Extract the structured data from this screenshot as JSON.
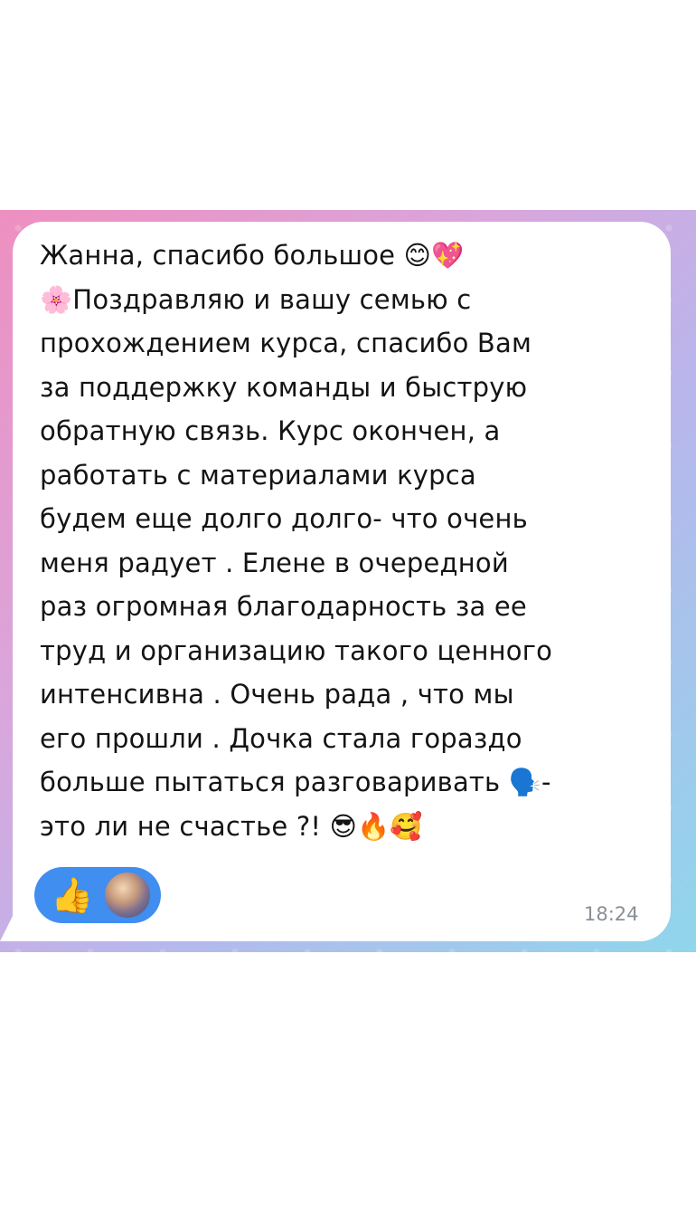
{
  "colors": {
    "bubble": "#ffffff",
    "reaction_pill": "#3f8ef0",
    "timestamp": "#8a8f96",
    "text": "#141414"
  },
  "message": {
    "lines": [
      "Жанна, спасибо большое 😊💖",
      "🌸Поздравляю и вашу семью с",
      "прохождением курса, спасибо Вам",
      "за поддержку  команды и быструю",
      "обратную связь. Курс окончен, а",
      "работать с материалами курса",
      "будем еще долго долго- что очень",
      "меня радует . Елене в очередной",
      "раз огромная благодарность за ее",
      "труд и организацию такого ценного",
      "интенсивна . Очень рада , что мы",
      "его прошли . Дочка стала гораздо",
      "больше пытаться разговаривать 🗣️-",
      "это ли не счастье ?! 😎🔥🥰"
    ],
    "time": "18:24"
  },
  "reaction": {
    "emoji": "👍",
    "icon": "thumbs-up-icon",
    "avatar": "user-avatar"
  }
}
